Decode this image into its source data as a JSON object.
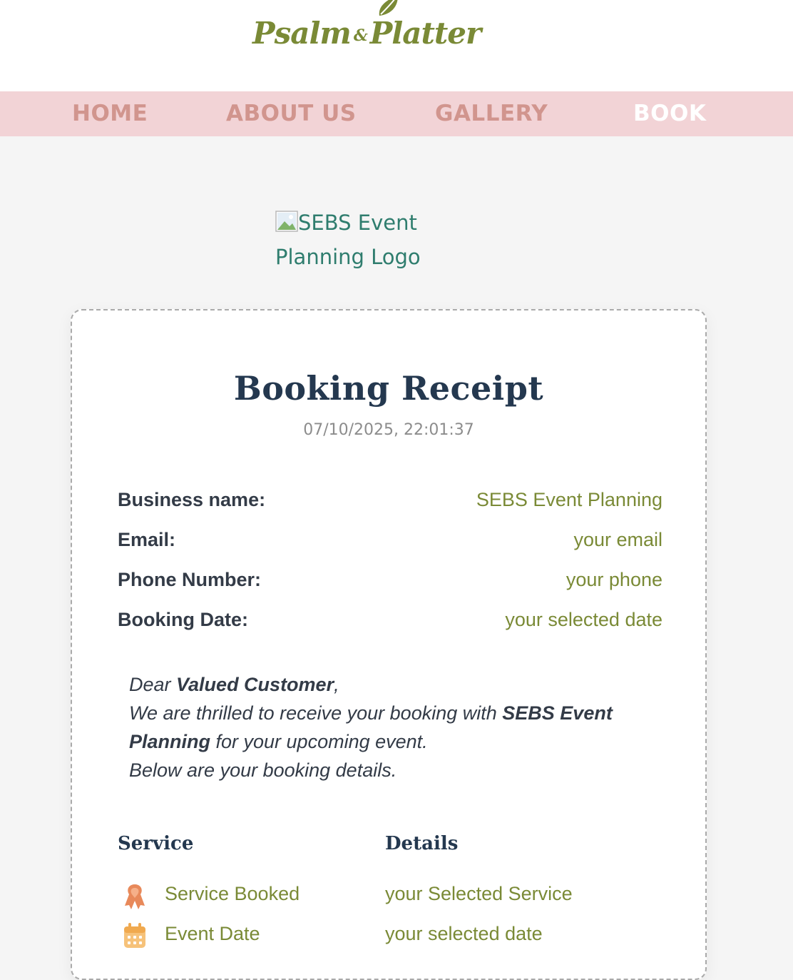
{
  "brand": {
    "name_left": "Psalm",
    "ampersand": "&",
    "name_right": "Platter",
    "color": "#7a8a36"
  },
  "nav": {
    "items": [
      {
        "label": "HOME"
      },
      {
        "label": "ABOUT US"
      },
      {
        "label": "GALLERY"
      },
      {
        "label": "BOOK",
        "active": true
      }
    ],
    "background": "#f2d3d6",
    "text_color": "#d1958e",
    "active_color": "#ffffff"
  },
  "logo_image": {
    "alt_text": "SEBS Event Planning Logo"
  },
  "receipt": {
    "title": "Booking Receipt",
    "timestamp": "07/10/2025, 22:01:37",
    "fields": [
      {
        "label": "Business name:",
        "value": "SEBS Event Planning"
      },
      {
        "label": "Email:",
        "value": "your email"
      },
      {
        "label": "Phone Number:",
        "value": "your phone"
      },
      {
        "label": "Booking Date:",
        "value": "your selected date"
      }
    ],
    "letter": {
      "greeting_prefix": "Dear ",
      "customer_name": "Valued Customer",
      "greeting_suffix": ",",
      "line1_prefix": "We are thrilled to receive your booking with ",
      "business_name": "SEBS Event Planning",
      "line1_suffix": " for your upcoming event.",
      "line2": "Below are your booking details."
    },
    "table": {
      "headers": [
        "Service",
        "Details"
      ],
      "rows": [
        {
          "icon": "ribbon-icon",
          "name": "Service Booked",
          "detail": "your Selected Service"
        },
        {
          "icon": "calendar-icon",
          "name": "Event Date",
          "detail": "your selected date"
        }
      ]
    },
    "colors": {
      "title": "#24384f",
      "value": "#7a8a36",
      "label": "#333b47"
    }
  }
}
